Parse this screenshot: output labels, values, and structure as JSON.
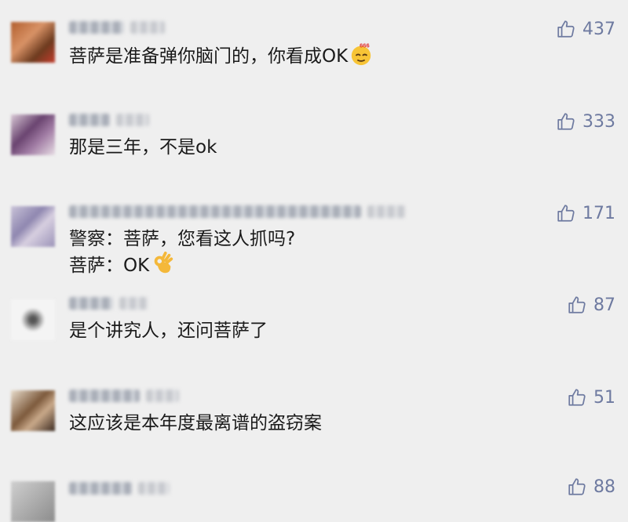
{
  "comments": [
    {
      "text": "菩萨是准备弹你脑门的，你看成OK",
      "likes": "437",
      "emoji": "666-face-emoji"
    },
    {
      "text": "那是三年，不是ok",
      "likes": "333"
    },
    {
      "lines": [
        "警察：菩萨，您看这人抓吗?",
        "菩萨：OK"
      ],
      "likes": "171",
      "emoji": "ok-hand-emoji"
    },
    {
      "text": "是个讲究人，还问菩萨了",
      "likes": "87"
    },
    {
      "text": "这应该是本年度最离谱的盗窃案",
      "likes": "51"
    },
    {
      "likes": "88"
    }
  ],
  "colors": {
    "background": "#efefef",
    "like": "#6e7aa0",
    "text": "#1a1a1a"
  },
  "icons": {
    "like": "thumbs-up-icon"
  }
}
